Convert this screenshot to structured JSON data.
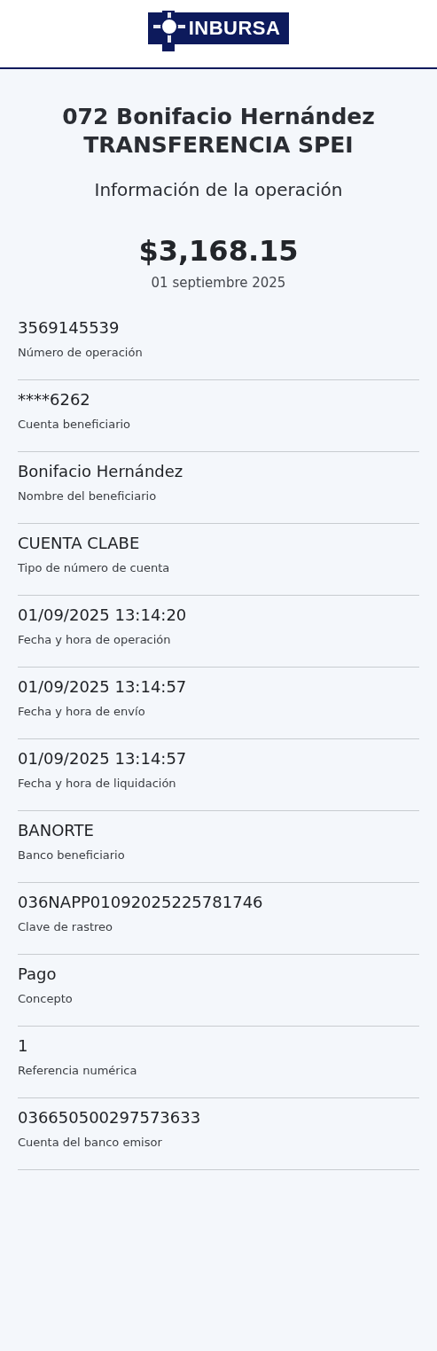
{
  "header": {
    "logo_text": "INBURSA"
  },
  "title": [
    "072 Bonifacio Hernández",
    "TRANSFERENCIA SPEI"
  ],
  "subtitle": "Información de la operación",
  "amount": "$3,168.15",
  "date": "01 septiembre 2025",
  "details": [
    {
      "value": "3569145539",
      "label": "Número de operación"
    },
    {
      "value": "****6262",
      "label": "Cuenta beneficiario"
    },
    {
      "value": "Bonifacio Hernández",
      "label": "Nombre del beneficiario"
    },
    {
      "value": "CUENTA CLABE",
      "label": "Tipo de número de cuenta"
    },
    {
      "value": "01/09/2025 13:14:20",
      "label": "Fecha y hora de operación"
    },
    {
      "value": "01/09/2025 13:14:57",
      "label": "Fecha y hora de envío"
    },
    {
      "value": "01/09/2025 13:14:57",
      "label": "Fecha y hora de liquidación"
    },
    {
      "value": "BANORTE",
      "label": "Banco beneficiario"
    },
    {
      "value": "036NAPP01092025225781746",
      "label": "Clave de rastreo"
    },
    {
      "value": "Pago",
      "label": "Concepto"
    },
    {
      "value": "1",
      "label": "Referencia numérica"
    },
    {
      "value": "036650500297573633",
      "label": "Cuenta del banco emisor"
    }
  ]
}
